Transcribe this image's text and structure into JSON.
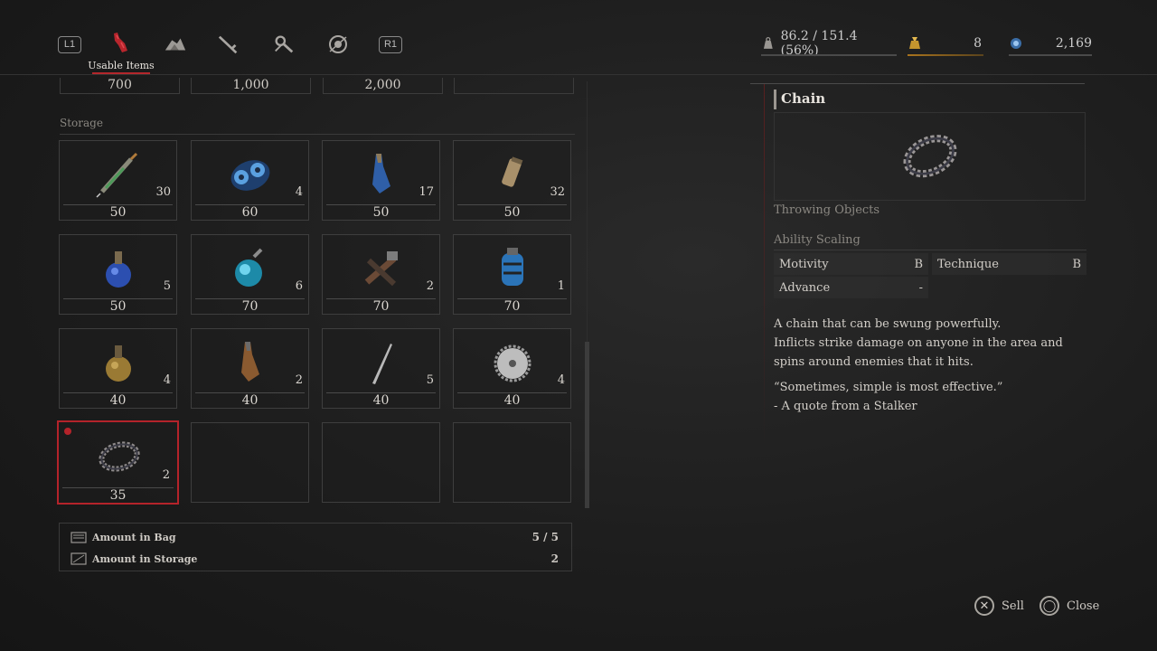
{
  "header": {
    "tabs": [
      {
        "icon": "l1-button-badge",
        "label": "L1"
      },
      {
        "icon": "usable-items-icon",
        "label": "Usable Items"
      },
      {
        "icon": "materials-icon"
      },
      {
        "icon": "weapon-icon"
      },
      {
        "icon": "tools-icon"
      },
      {
        "icon": "amulet-icon"
      },
      {
        "icon": "r1-button-badge",
        "label": "R1"
      }
    ],
    "active_tab": "Usable Items",
    "weight": "86.2 / 151.4 (56%)",
    "gold_count": "8",
    "ergo": "2,169"
  },
  "grid": {
    "top_prices": [
      "700",
      "1,000",
      "2,000",
      ""
    ],
    "section_label": "Storage",
    "rows": [
      [
        {
          "icon": "syringe-icon",
          "count": "30",
          "price": "50"
        },
        {
          "icon": "blue-disc-bomb-icon",
          "count": "4",
          "price": "60"
        },
        {
          "icon": "blue-vial-icon",
          "count": "17",
          "price": "50"
        },
        {
          "icon": "canister-icon",
          "count": "32",
          "price": "50"
        }
      ],
      [
        {
          "icon": "blue-flask-icon",
          "count": "5",
          "price": "50"
        },
        {
          "icon": "cyan-grenade-icon",
          "count": "6",
          "price": "70"
        },
        {
          "icon": "crossed-tools-icon",
          "count": "2",
          "price": "70"
        },
        {
          "icon": "electric-jar-icon",
          "count": "1",
          "price": "70"
        }
      ],
      [
        {
          "icon": "amber-flask-icon",
          "count": "4",
          "price": "40"
        },
        {
          "icon": "amber-vial-icon",
          "count": "2",
          "price": "40"
        },
        {
          "icon": "throwing-knife-icon",
          "count": "5",
          "price": "40"
        },
        {
          "icon": "saw-blade-icon",
          "count": "4",
          "price": "40"
        }
      ],
      [
        {
          "icon": "chain-icon",
          "count": "2",
          "price": "35",
          "selected": true
        },
        {
          "icon": "",
          "count": "",
          "price": ""
        },
        {
          "icon": "",
          "count": "",
          "price": ""
        },
        {
          "icon": "",
          "count": "",
          "price": ""
        }
      ]
    ]
  },
  "summary": {
    "bag_label": "Amount in Bag",
    "bag_value": "5 / 5",
    "storage_label": "Amount in Storage",
    "storage_value": "2"
  },
  "detail": {
    "title": "Chain",
    "icon": "chain-icon",
    "category": "Throwing Objects",
    "scaling_label": "Ability Scaling",
    "scaling": [
      {
        "stat": "Motivity",
        "grade": "B"
      },
      {
        "stat": "Technique",
        "grade": "B"
      },
      {
        "stat": "Advance",
        "grade": "-"
      }
    ],
    "description_line1": "A chain that can be swung powerfully.",
    "description_line2": "Inflicts strike damage on anyone in the area and spins around enemies that it hits.",
    "quote_line1": "“Sometimes, simple is most effective.”",
    "quote_line2": "- A quote from a Stalker"
  },
  "hints": {
    "sell": "Sell",
    "close": "Close"
  },
  "colors": {
    "accent": "#b4232a",
    "background": "#1d1d1d",
    "text": "#d3cfc9",
    "muted": "#8a8781"
  }
}
